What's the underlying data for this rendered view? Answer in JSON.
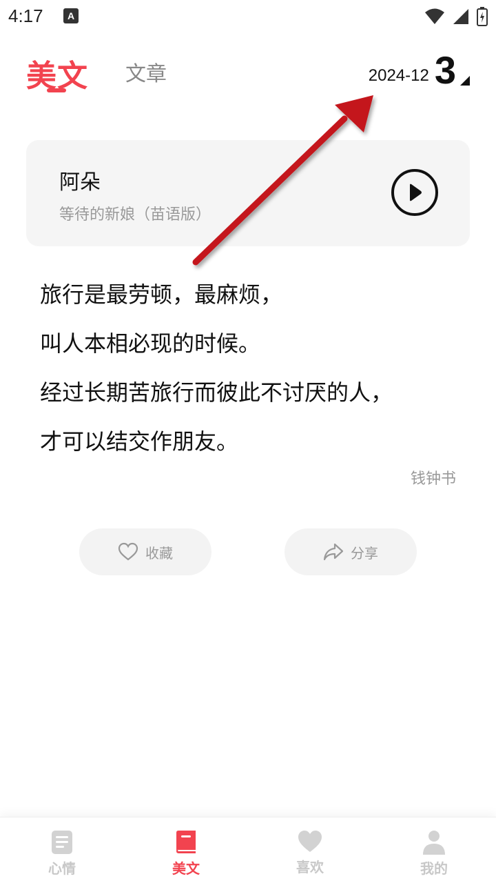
{
  "status_bar": {
    "time": "4:17",
    "notif_letter": "A"
  },
  "header": {
    "active_tab": "美文",
    "inactive_tab": "文章",
    "date_year_month": "2024-12",
    "date_day": "3"
  },
  "music": {
    "artist": "阿朵",
    "song": "等待的新娘（苗语版）"
  },
  "quote": {
    "lines": [
      "旅行是最劳顿，最麻烦，",
      "叫人本相必现的时候。",
      "经过长期苦旅行而彼此不讨厌的人，",
      "才可以结交作朋友。"
    ],
    "author": "钱钟书"
  },
  "actions": {
    "favorite_label": "收藏",
    "share_label": "分享"
  },
  "nav": {
    "items": [
      {
        "label": "心情",
        "icon": "document-icon"
      },
      {
        "label": "美文",
        "icon": "book-icon"
      },
      {
        "label": "喜欢",
        "icon": "heart-icon"
      },
      {
        "label": "我的",
        "icon": "person-icon"
      }
    ],
    "active_index": 1
  },
  "colors": {
    "accent": "#f2434f",
    "arrow": "#c4141b",
    "card_bg": "#f5f5f5"
  }
}
